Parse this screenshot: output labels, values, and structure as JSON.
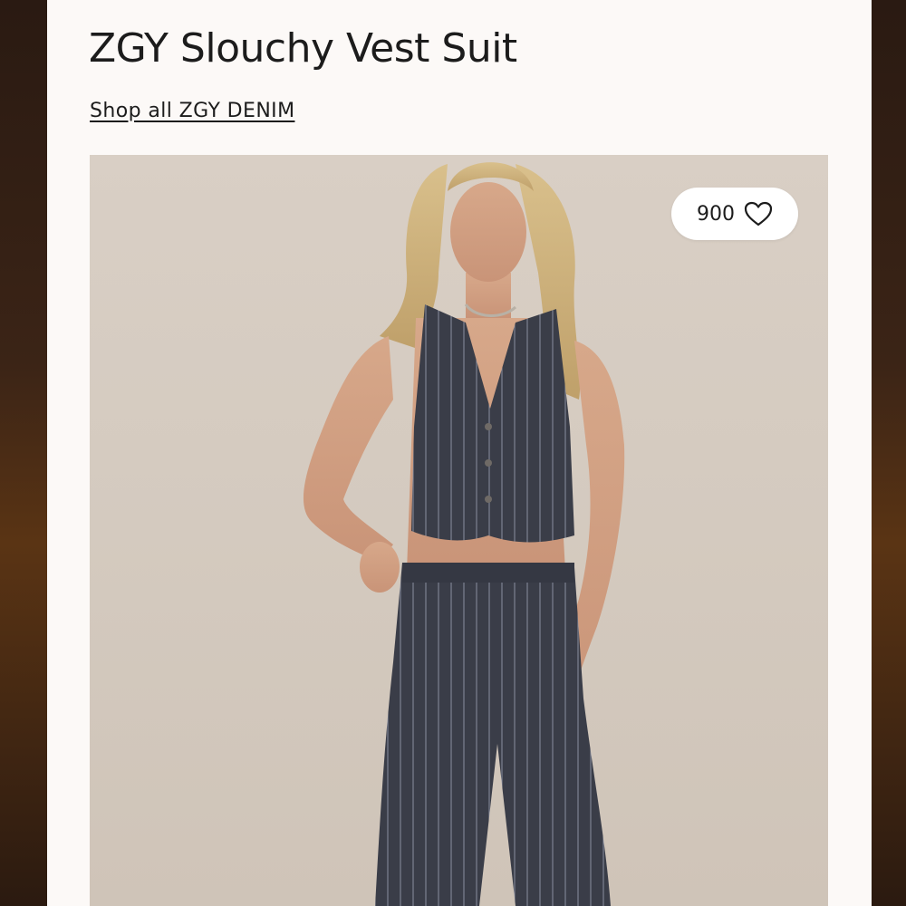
{
  "product": {
    "title": "ZGY Slouchy Vest Suit",
    "shop_link_label": "Shop all ZGY DENIM"
  },
  "image": {
    "subject": "model wearing pinstripe vest and trousers"
  },
  "favorites": {
    "count": "900",
    "icon": "heart-outline-icon"
  },
  "colors": {
    "page_background": "#fcf9f7",
    "image_backdrop": "#d6ccc1",
    "garment": "#3a3d48",
    "text": "#1c1c1c"
  }
}
